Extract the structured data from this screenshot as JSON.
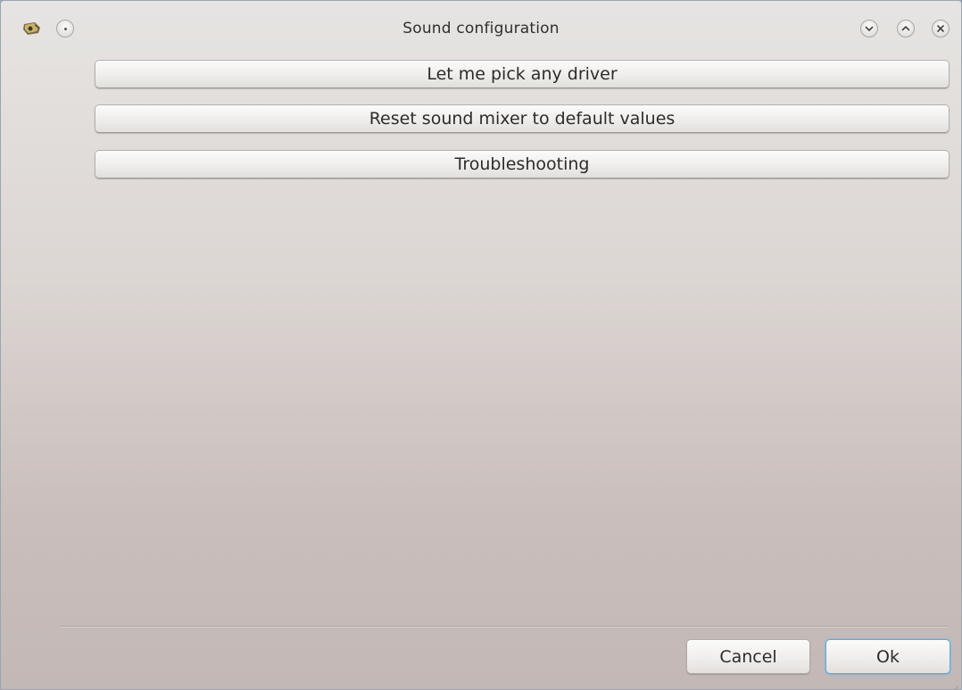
{
  "window": {
    "title": "Sound configuration",
    "icons": {
      "app": "sound-card-icon",
      "pin": "pin-icon",
      "minimize": "chevron-down-icon",
      "maximize": "chevron-up-icon",
      "close": "close-icon"
    }
  },
  "actions": {
    "pick_driver": "Let me pick any driver",
    "reset_mixer": "Reset sound mixer to default values",
    "troubleshooting": "Troubleshooting"
  },
  "footer": {
    "cancel_label": "Cancel",
    "ok_label": "Ok"
  },
  "colors": {
    "focus_accent": "#5fa9e0"
  }
}
